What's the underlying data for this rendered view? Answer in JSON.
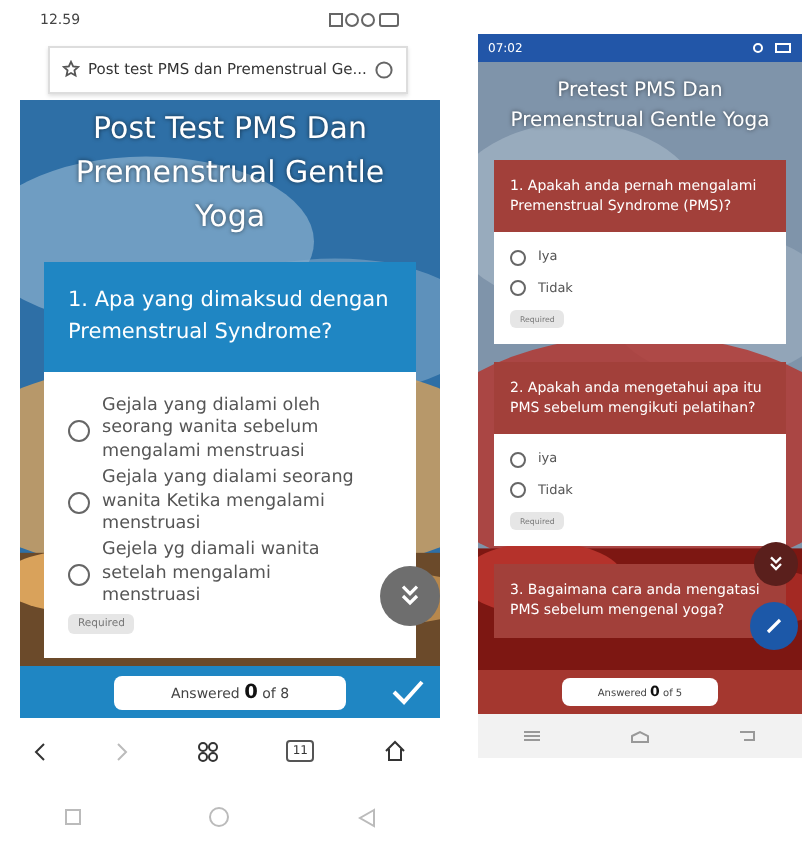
{
  "phones": [
    {
      "kind": "browser",
      "status_time": "12.59",
      "address": "Post test PMS dan Premenstrual Ge...",
      "title": "Post Test PMS Dan Premenstrual Gentle Yoga",
      "questions": [
        {
          "text": "1. Apa yang dimaksud dengan Premenstrual Syndrome?",
          "required": "Required",
          "options": [
            {
              "label": "Gejala yang dialami oleh seorang wanita sebelum mengalami menstruasi",
              "selected": false
            },
            {
              "label": "Gejala yang dialami seorang wanita Ketika mengalami menstruasi",
              "selected": false
            },
            {
              "label": "Gejela yg diamali wanita setelah mengalami menstruasi",
              "selected": false
            }
          ]
        }
      ],
      "answered": "Answered **0** of 8",
      "tab_count": "11"
    },
    {
      "kind": "app",
      "status_time": "07:02",
      "title": "Pretest PMS Dan Premenstrual Gentle Yoga",
      "questions": [
        {
          "text": "1. Apakah anda pernah mengalami Premenstrual Syndrome (PMS)?",
          "required": "Required",
          "options": [
            {
              "label": "Iya",
              "selected": false
            },
            {
              "label": "Tidak",
              "selected": false
            }
          ]
        },
        {
          "text": "2. Apakah anda mengetahui apa itu PMS sebelum mengikuti pelatihan?",
          "required": "Required",
          "options": [
            {
              "label": "iya",
              "selected": false
            },
            {
              "label": "Tidak",
              "selected": false
            }
          ]
        },
        {
          "text": "3. Bagaimana cara anda mengatasi PMS sebelum mengenal yoga?"
        }
      ],
      "answered": "Answered **0** of 5"
    }
  ]
}
